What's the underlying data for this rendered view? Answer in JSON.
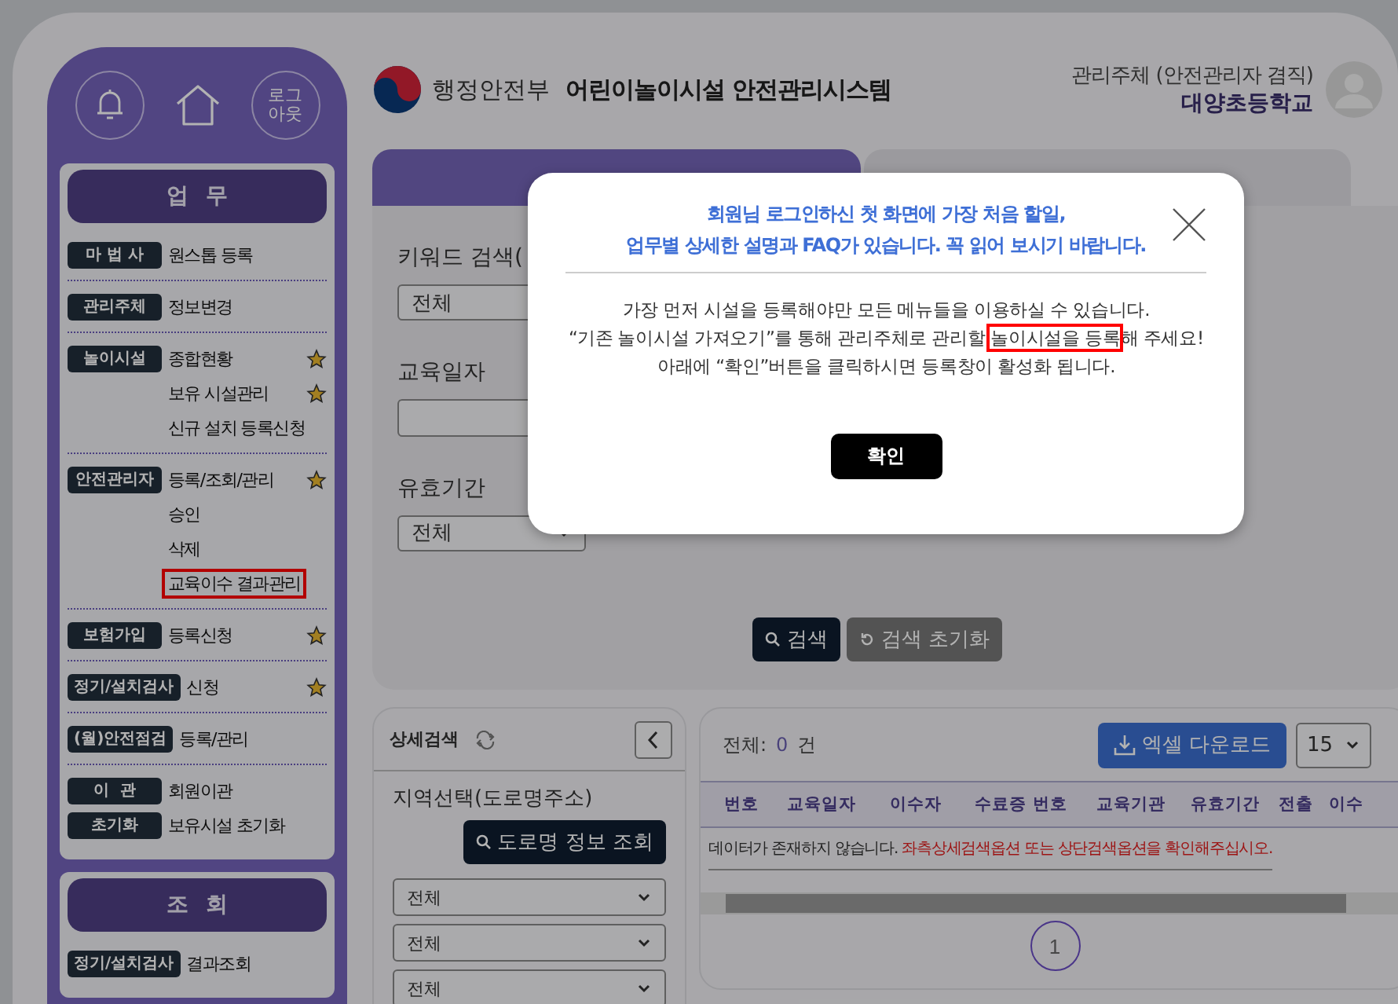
{
  "sidebar": {
    "logout_label": "로그\n아웃",
    "sections": [
      {
        "title": "업 무",
        "groups": [
          {
            "rows": [
              {
                "badge": "마 법 사",
                "label": "원스톱 등록",
                "starred": false,
                "highlighted": false
              }
            ]
          },
          {
            "rows": [
              {
                "badge": "관리주체",
                "label": "정보변경",
                "starred": false,
                "highlighted": false
              }
            ]
          },
          {
            "rows": [
              {
                "badge": "놀이시설",
                "label": "종합현황",
                "starred": true,
                "highlighted": false
              },
              {
                "label": "보유 시설관리",
                "starred": true,
                "highlighted": false
              },
              {
                "label": "신규 설치 등록신청",
                "starred": false,
                "highlighted": false
              }
            ]
          },
          {
            "rows": [
              {
                "badge": "안전관리자",
                "label": "등록/조회/관리",
                "starred": true,
                "highlighted": false
              },
              {
                "label": "승인",
                "starred": false,
                "highlighted": false
              },
              {
                "label": "삭제",
                "starred": false,
                "highlighted": false
              },
              {
                "label": "교육이수 결과관리",
                "starred": false,
                "highlighted": true
              }
            ]
          },
          {
            "rows": [
              {
                "badge": "보험가입",
                "label": "등록신청",
                "starred": true,
                "highlighted": false
              }
            ]
          },
          {
            "rows": [
              {
                "badge": "정기/설치검사",
                "label": "신청",
                "starred": true,
                "highlighted": false
              }
            ]
          },
          {
            "rows": [
              {
                "badge": "(월)안전점검",
                "label": "등록/관리",
                "starred": false,
                "highlighted": false
              }
            ]
          },
          {
            "rows": [
              {
                "badge": "이  관",
                "label": "회원이관",
                "starred": false,
                "highlighted": false
              },
              {
                "badge": "초기화",
                "label": "보유시설 초기화",
                "starred": false,
                "highlighted": false
              }
            ]
          }
        ]
      },
      {
        "title": "조 회",
        "groups": [
          {
            "rows": [
              {
                "badge": "정기/설치검사",
                "label": "결과조회",
                "starred": false,
                "highlighted": false
              }
            ]
          }
        ]
      }
    ]
  },
  "header": {
    "ministry": "행정안전부",
    "system": "어린이놀이시설 안전관리시스템",
    "user_role": "관리주체 (안전관리자 겸직)",
    "user_name": "대양초등학교"
  },
  "tabs": [
    {
      "selected": true
    },
    {
      "selected": false
    }
  ],
  "search": {
    "keyword_label": "키워드 검색(",
    "keyword_select": "전체",
    "date_label": "교육일자",
    "validity_label": "유효기간",
    "validity_select": "전체",
    "search_button": "검색",
    "reset_button": "검색 초기화"
  },
  "detail_search": {
    "title": "상세검색",
    "region_label": "지역선택(도로명주소)",
    "road_button": "도로명 정보 조회",
    "selects": [
      "전체",
      "전체",
      "전체"
    ]
  },
  "results": {
    "total_label": "전체:",
    "total_count": "0",
    "total_unit": "건",
    "excel_button": "엑셀 다운로드",
    "page_size": "15",
    "columns": [
      "번호",
      "교육일자",
      "이수자",
      "수료증 번호",
      "교육기관",
      "유효기간",
      "전출",
      "이수"
    ],
    "empty_message": "데이터가 존재하지 않습니다.",
    "empty_hint": "좌측상세검색옵션 또는 상단검색옵션을 확인해주십시오.",
    "pages": [
      {
        "label": "1",
        "selected": true
      }
    ]
  },
  "modal": {
    "title_lines": [
      "회원님 로그인하신 첫 화면에 가장 처음 할일,",
      "업무별 상세한 설명과 FAQ가 있습니다. 꼭 읽어 보시기 바랍니다."
    ],
    "body": [
      {
        "text": "가장 먼저 시설을 등록해야만 모든 메뉴들을 이용하실 수 있습니다."
      },
      {
        "text": "“기존 놀이시설 가져오기”를 통해 관리주체로 관리할 ",
        "highlight": "놀이시설을 등록",
        "after": "해 주세요!"
      },
      {
        "text": "아래에 “확인”버튼을 클릭하시면 등록창이 활성화 됩니다."
      }
    ],
    "confirm_button": "확인"
  }
}
